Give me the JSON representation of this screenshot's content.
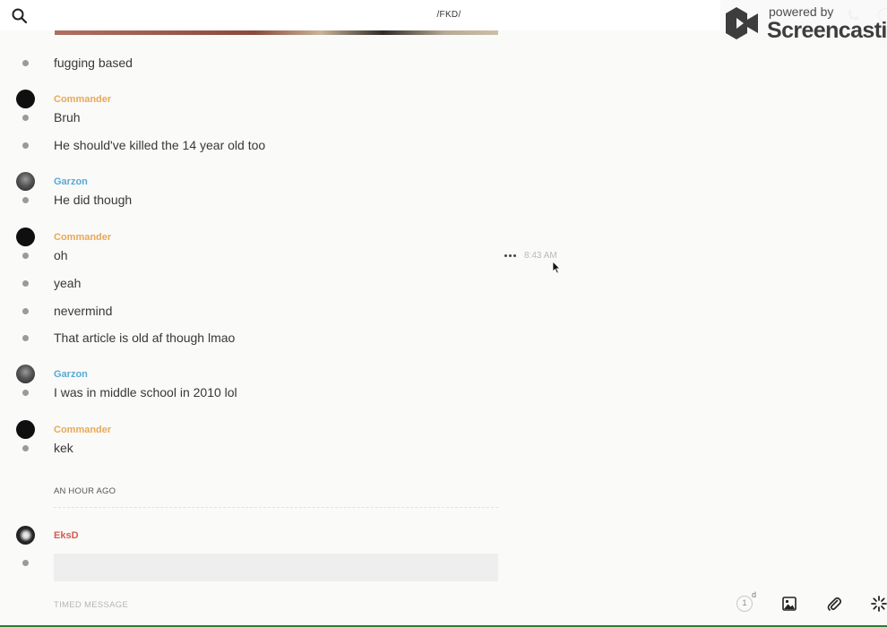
{
  "header": {
    "channel_title": "/FKD/",
    "icons": [
      "search-icon",
      "phone-icon",
      "info-icon"
    ]
  },
  "watermark": {
    "small_text": "powered by",
    "brand_text": "Screencastify"
  },
  "messages": [
    {
      "type": "message",
      "text": "fugging based"
    },
    {
      "type": "author",
      "name": "Commander",
      "color": "#e8a858"
    },
    {
      "type": "message",
      "text": "Bruh"
    },
    {
      "type": "message",
      "text": "He should've killed the 14 year old too"
    },
    {
      "type": "author",
      "name": "Garzon",
      "color": "#5aa9d3"
    },
    {
      "type": "message",
      "text": "He did though"
    },
    {
      "type": "author",
      "name": "Commander",
      "color": "#e8a858"
    },
    {
      "type": "message",
      "text": "oh",
      "time": "8:43 AM"
    },
    {
      "type": "message",
      "text": "yeah"
    },
    {
      "type": "message",
      "text": "nevermind"
    },
    {
      "type": "message",
      "text": "That article is old af though lmao"
    },
    {
      "type": "author",
      "name": "Garzon",
      "color": "#5aa9d3"
    },
    {
      "type": "message",
      "text": "I was in middle school in 2010 lol"
    },
    {
      "type": "author",
      "name": "Commander",
      "color": "#e8a858"
    },
    {
      "type": "message",
      "text": "kek"
    },
    {
      "type": "divider",
      "text": "AN HOUR AGO"
    },
    {
      "type": "author",
      "name": "EksD",
      "color": "#d45c52"
    }
  ],
  "composer": {
    "placeholder": "TIMED MESSAGE",
    "timer_value": "1",
    "timer_unit": "d",
    "icons": [
      "timer-icon",
      "image-icon",
      "paperclip-icon",
      "sparkle-icon"
    ]
  }
}
